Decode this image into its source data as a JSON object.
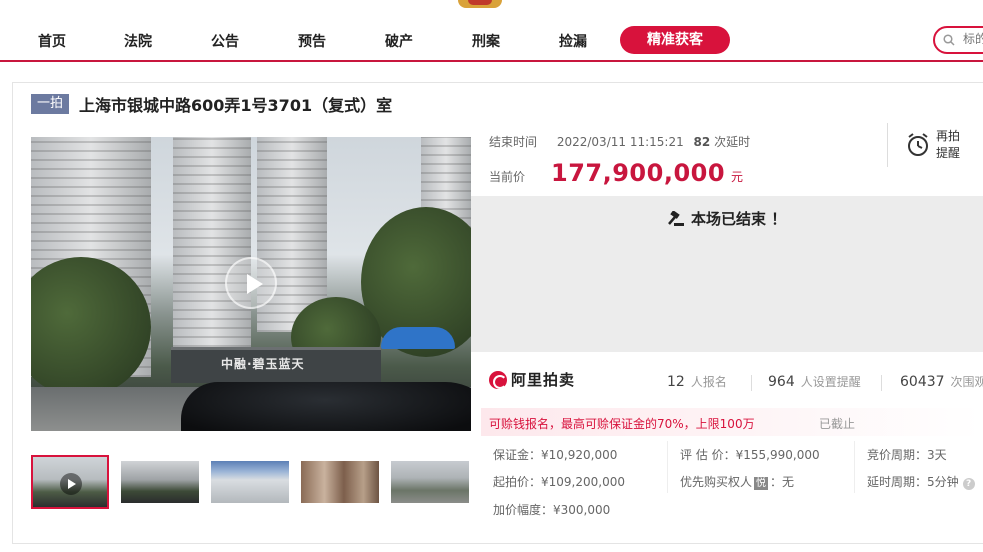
{
  "nav": {
    "items": [
      "首页",
      "法院",
      "公告",
      "预告",
      "破产",
      "刑案",
      "捡漏"
    ],
    "cta": "精准获客",
    "search_placeholder": "标的"
  },
  "lot": {
    "badge": "一拍",
    "title": "上海市银城中路600弄1号3701（复式）室"
  },
  "media": {
    "sign_text": "中融·碧玉蓝天"
  },
  "auction": {
    "end_label": "结束时间",
    "end_time": "2022/03/11 11:15:21",
    "delay_count": "82",
    "delay_text": "次延时",
    "remind_label": "再拍提醒",
    "price_label": "当前价",
    "price": "177,900,000",
    "price_unit": "元",
    "ended_message": "本场已结束 ！"
  },
  "stats": {
    "platform": "阿里拍卖",
    "signups": "12",
    "signups_label": "人报名",
    "reminders": "964",
    "reminders_label": "人设置提醒",
    "views": "60437",
    "views_label": "次围观"
  },
  "deposit": {
    "text": "可赊钱报名，最高可赊保证金的70%，上限100万",
    "status": "已截止"
  },
  "details": {
    "deposit_label": "保证金：",
    "deposit_value": "¥10,920,000",
    "start_label": "起拍价：",
    "start_value": "¥109,200,000",
    "step_label": "加价幅度：",
    "step_value": "¥300,000",
    "appraisal_label": "评 估 价：",
    "appraisal_value": "¥155,990,000",
    "priority_label": "优先购买权人",
    "priority_box": "悦",
    "priority_value": "：无",
    "cycle_label": "竞价周期：",
    "cycle_value": "3天",
    "delay_label": "延时周期：",
    "delay_value": "5分钟"
  },
  "colors": {
    "brand": "#d8123c",
    "price": "#c8163e",
    "badge": "#6c7aa0"
  }
}
